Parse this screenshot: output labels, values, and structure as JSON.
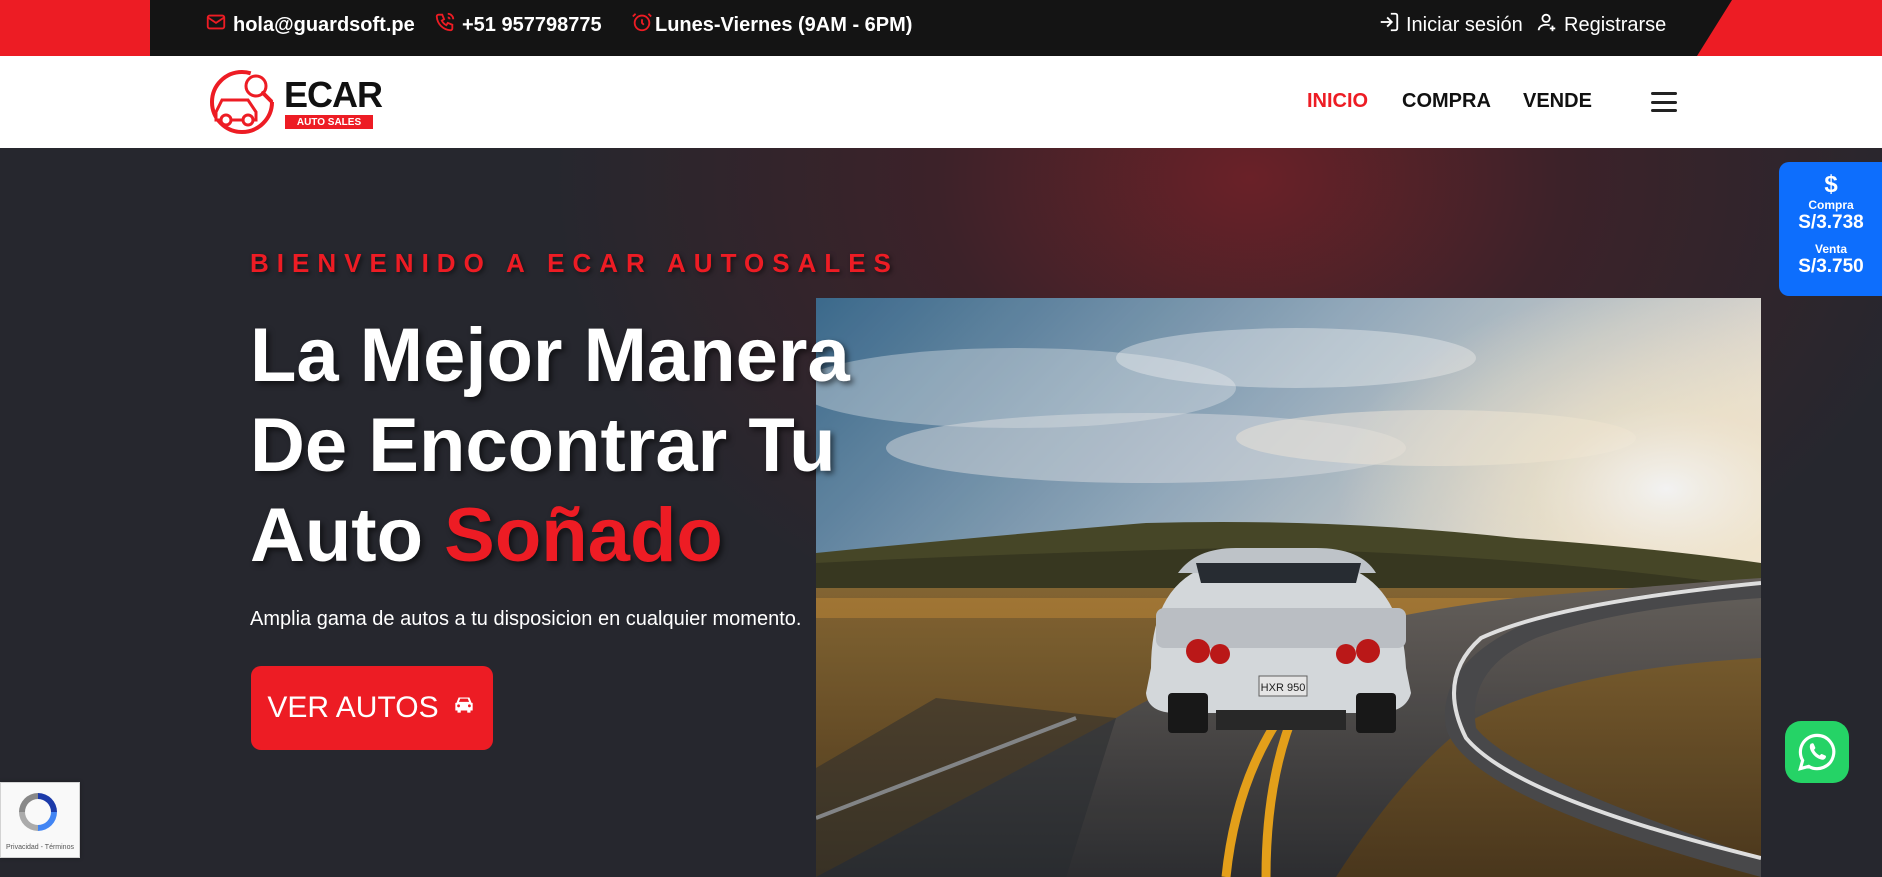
{
  "topbar": {
    "email": "hola@guardsoft.pe",
    "phone": "+51 957798775",
    "hours": "Lunes-Viernes (9AM - 6PM)",
    "login": "Iniciar sesión",
    "register": "Registrarse",
    "accent_color": "#ed1c24"
  },
  "logo": {
    "name": "ECAR",
    "tagline": "AUTO SALES"
  },
  "nav": {
    "items": [
      {
        "label": "INICIO",
        "active": true
      },
      {
        "label": "COMPRA",
        "active": false
      },
      {
        "label": "VENDE",
        "active": false
      }
    ],
    "menu_icon": "hamburger-icon"
  },
  "hero": {
    "eyebrow": "BIENVENIDO A ECAR AUTOSALES",
    "headline_line1": "La Mejor Manera",
    "headline_line2": "De Encontrar Tu",
    "headline_line3_plain": "Auto ",
    "headline_line3_accent": "Soñado",
    "subtext": "Amplia gama de autos a tu disposicion en cualquier momento.",
    "cta_label": "VER AUTOS",
    "photo_plate": "HXR 950"
  },
  "exchange": {
    "symbol": "$",
    "buy_label": "Compra",
    "buy_value": "S/3.738",
    "sell_label": "Venta",
    "sell_value": "S/3.750"
  },
  "recaptcha": {
    "text": "Privacidad - Términos"
  },
  "colors": {
    "brand_red": "#ed1c24",
    "dark_bg": "#26272e",
    "fx_blue": "#0d6efd",
    "whatsapp_green": "#25d366"
  }
}
